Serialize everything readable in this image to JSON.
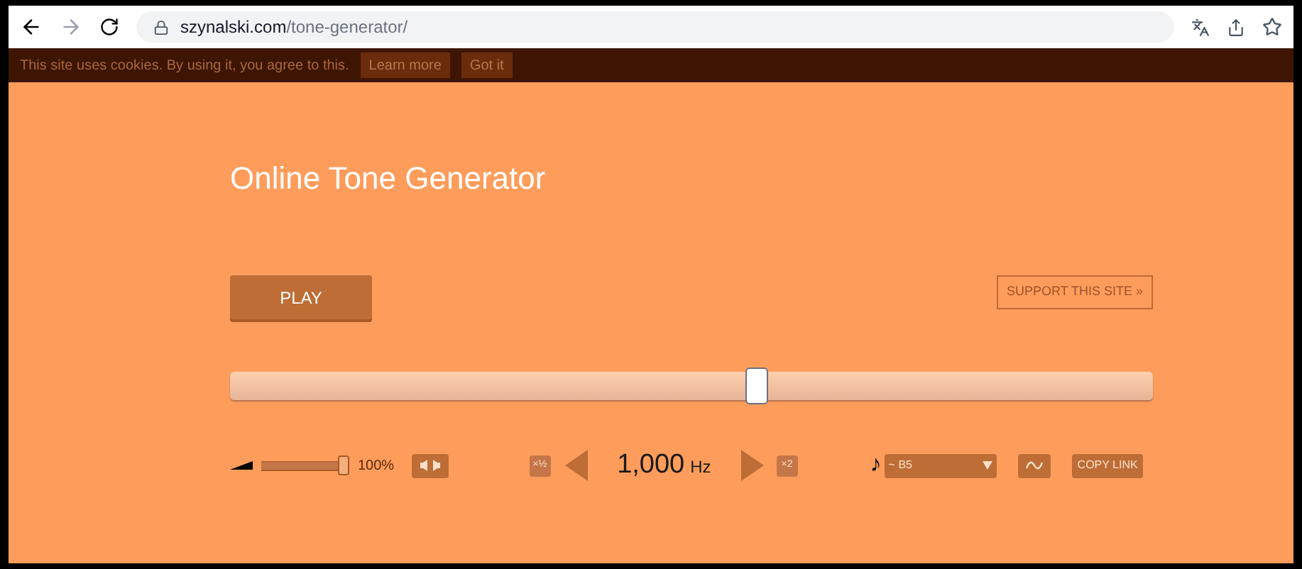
{
  "browser": {
    "url_host": "szynalski.com",
    "url_path": "/tone-generator/"
  },
  "cookie_bar": {
    "message": "This site uses cookies. By using it, you agree to this.",
    "buttons": [
      "Learn more",
      "Got it"
    ]
  },
  "title": "Online Tone Generator",
  "play_button": "PLAY",
  "support_link": "SUPPORT THIS SITE »",
  "frequency_slider": {
    "level": 0.57
  },
  "volume": {
    "level": 1,
    "reading": "100%"
  },
  "half_button": "×½",
  "frequency": {
    "value": "1,000",
    "unit": "Hz"
  },
  "double_button": "×2",
  "note_icon": "♪",
  "note_select": {
    "value": "~ B5"
  },
  "copy_link": "COPY LINK"
}
